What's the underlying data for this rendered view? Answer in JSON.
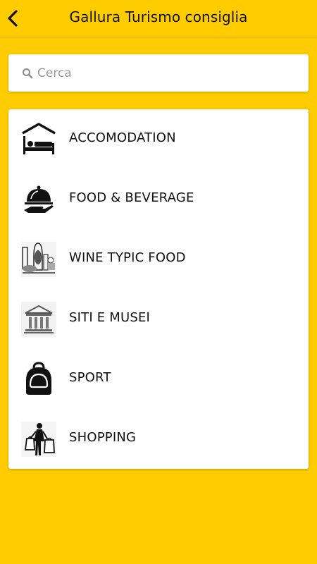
{
  "header": {
    "title": "Gallura Turismo consiglia",
    "back_icon": "back-arrow-icon"
  },
  "search": {
    "placeholder": "Cerca",
    "value": "",
    "icon": "search-icon"
  },
  "categories": [
    {
      "label": "ACCOMODATION",
      "icon": "hotel-bed-icon"
    },
    {
      "label": "FOOD & BEVERAGE",
      "icon": "food-cloche-icon"
    },
    {
      "label": "WINE TYPIC FOOD",
      "icon": "wine-food-icon"
    },
    {
      "label": "SITI E MUSEI",
      "icon": "museum-icon"
    },
    {
      "label": "SPORT",
      "icon": "backpack-icon"
    },
    {
      "label": "SHOPPING",
      "icon": "shopping-bags-icon"
    }
  ],
  "colors": {
    "background": "#FFCC00",
    "card": "#FFFFFF",
    "text": "#111111"
  }
}
